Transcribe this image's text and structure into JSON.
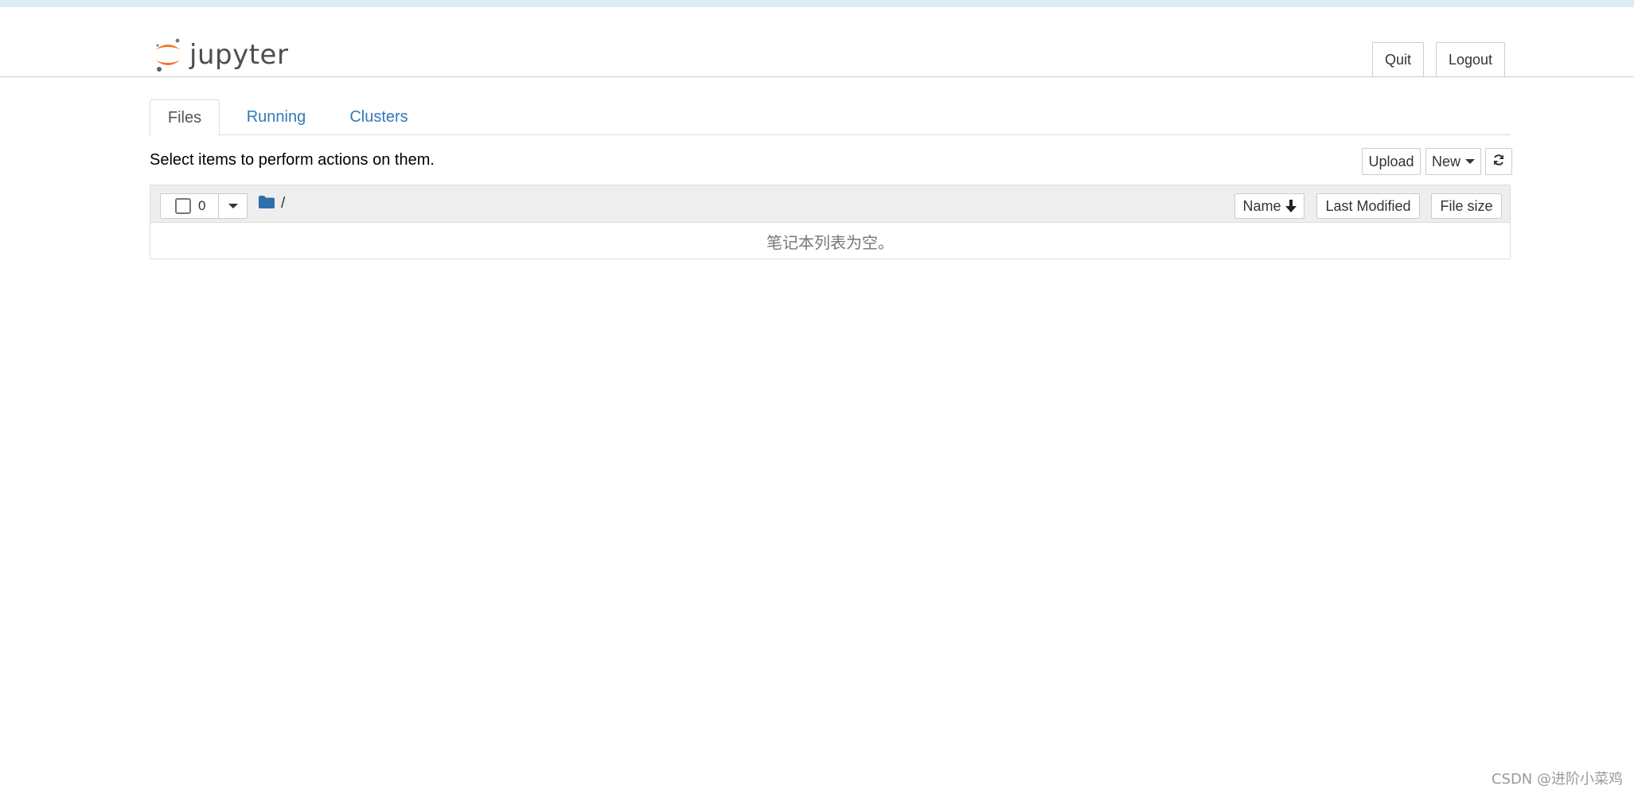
{
  "app": {
    "logo_text": "jupyter",
    "accent_color": "#f37626"
  },
  "header": {
    "quit_label": "Quit",
    "logout_label": "Logout"
  },
  "tabs": [
    {
      "label": "Files",
      "active": true
    },
    {
      "label": "Running",
      "active": false
    },
    {
      "label": "Clusters",
      "active": false
    }
  ],
  "toolbar": {
    "hint": "Select items to perform actions on them.",
    "upload_label": "Upload",
    "new_label": "New",
    "refresh_icon": "refresh-icon"
  },
  "file_list": {
    "selected_count": "0",
    "breadcrumb": "/",
    "sort_name_label": "Name",
    "sort_modified_label": "Last Modified",
    "sort_size_label": "File size",
    "empty_message": "笔记本列表为空。"
  },
  "watermark": "CSDN @进阶小菜鸡"
}
